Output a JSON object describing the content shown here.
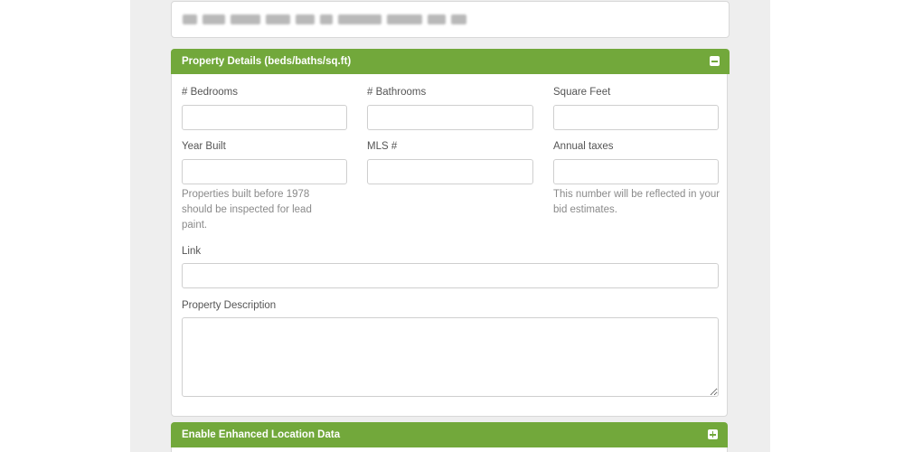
{
  "address": {
    "value": ""
  },
  "property_details": {
    "title": "Property Details (beds/baths/sq.ft)",
    "toggle_icon": "minus-square-icon",
    "fields": {
      "bedrooms": {
        "label": "# Bedrooms",
        "value": ""
      },
      "bathrooms": {
        "label": "# Bathrooms",
        "value": ""
      },
      "square_feet": {
        "label": "Square Feet",
        "value": ""
      },
      "year_built": {
        "label": "Year Built",
        "value": "",
        "help": "Properties built before 1978 should be inspected for lead paint."
      },
      "mls": {
        "label": "MLS #",
        "value": ""
      },
      "annual_taxes": {
        "label": "Annual taxes",
        "value": "",
        "help": "This number will be reflected in your bid estimates."
      },
      "link": {
        "label": "Link",
        "value": ""
      },
      "description": {
        "label": "Property Description",
        "value": ""
      }
    }
  },
  "enhanced_location": {
    "title": "Enable Enhanced Location Data",
    "toggle_icon": "plus-square-icon"
  },
  "colors": {
    "accent": "#72a83b",
    "background": "#eeeeee"
  }
}
